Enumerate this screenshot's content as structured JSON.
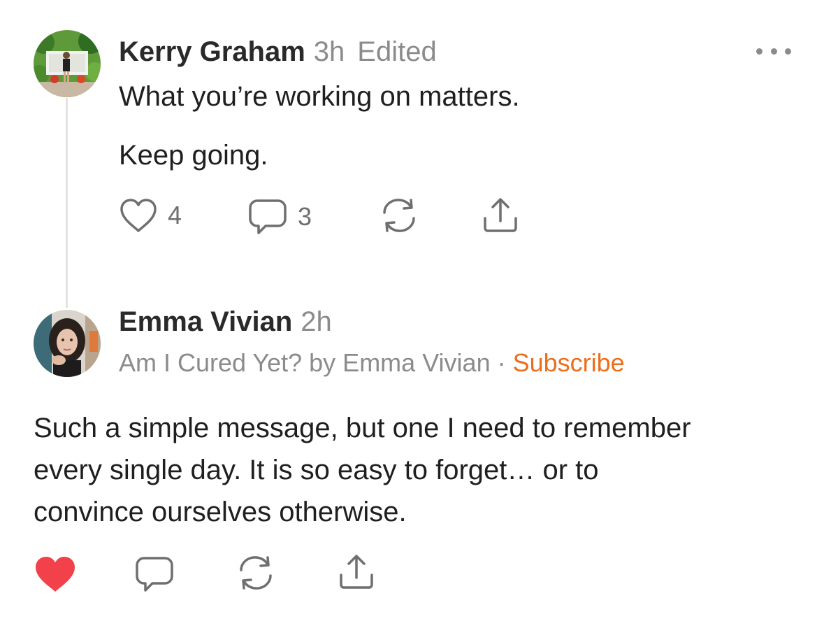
{
  "comment1": {
    "author": "Kerry Graham",
    "time": "3h",
    "edited": "Edited",
    "more_icon": "more-horizontal-icon",
    "paragraphs": [
      "What you’re working on matters.",
      "Keep going."
    ],
    "actions": {
      "like_count": "4",
      "comment_count": "3",
      "like_icon": "heart-outline-icon",
      "comment_icon": "comment-icon",
      "restack_icon": "restack-icon",
      "share_icon": "share-icon"
    }
  },
  "comment2": {
    "author": "Emma Vivian",
    "time": "2h",
    "publication": "Am I Cured Yet? by Emma Vivian",
    "separator": "·",
    "subscribe": "Subscribe",
    "lines": [
      "Such a simple message, but one I need to remember",
      "every single day. It is so easy to forget… or to",
      "convince ourselves otherwise."
    ],
    "actions": {
      "liked": true,
      "like_icon": "heart-filled-icon",
      "comment_icon": "comment-icon",
      "restack_icon": "restack-icon",
      "share_icon": "share-icon"
    }
  },
  "colors": {
    "accent": "#ee6d1a",
    "liked": "#f2414b",
    "meta": "#8b8b8b",
    "text": "#1f1f1f"
  }
}
